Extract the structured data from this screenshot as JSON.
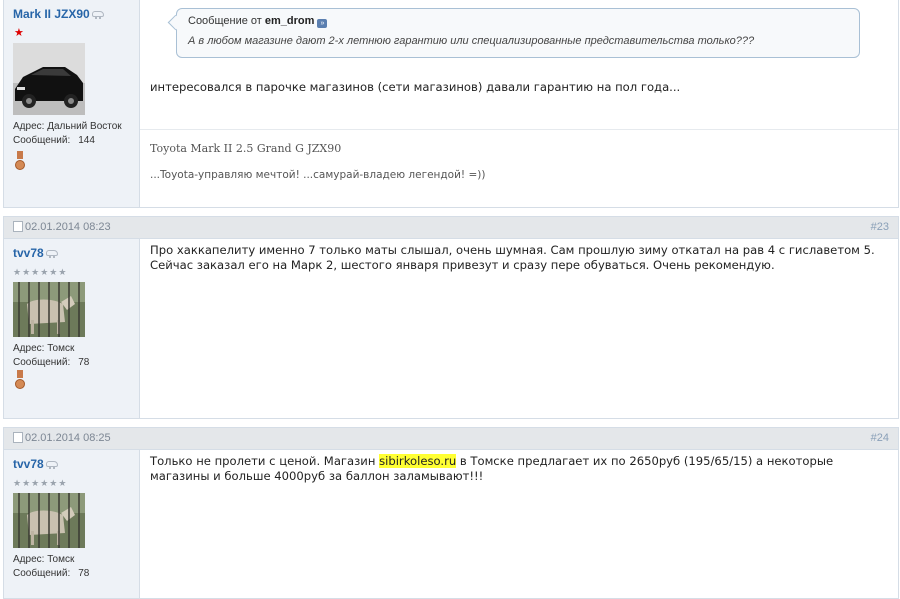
{
  "posts": [
    {
      "username": "Mark II JZX90",
      "address_label": "Адрес:",
      "address": "Дальний Восток",
      "messages_label": "Сообщений:",
      "messages": "144",
      "quote": {
        "prefix": "Сообщение от",
        "author": "em_drom",
        "text": "А в любом магазине дают 2-х летнюю гарантию или специализированные представительства только???"
      },
      "body": "интересовался в парочке магазинов (сети магазинов) давали гарантию на пол года...",
      "signature_line1": "Toyota Mark II 2.5 Grand G JZX90",
      "signature_line2": "...Toyota-управляю мечтой! ...самурай-владею легендой! =))"
    },
    {
      "date": "02.01.2014 08:23",
      "number": "#23",
      "username": "tvv78",
      "stars": "★★★★★★",
      "address_label": "Адрес:",
      "address": "Томск",
      "messages_label": "Сообщений:",
      "messages": "78",
      "body_line1": "Про хаккапелиту именно 7 только маты слышал, очень шумная. Сам прошлую зиму откатал на рав 4 с гиславетом 5.",
      "body_line2": "Сейчас заказал его на Марк 2, шестого января привезут и сразу пере обуваться. Очень рекомендую."
    },
    {
      "date": "02.01.2014 08:25",
      "number": "#24",
      "username": "tvv78",
      "stars": "★★★★★★",
      "address_label": "Адрес:",
      "address": "Томск",
      "messages_label": "Сообщений:",
      "messages": "78",
      "body_line1_pre": "Только не пролети с ценой. Магазин ",
      "body_link": "sibirkoleso.ru",
      "body_line1_post": " в Томске предлагает их по 2650руб (195/65/15) а некоторые",
      "body_line2": "магазины и больше 4000руб за баллон заламывают!!!"
    }
  ],
  "colors": {
    "username": "#2765a8",
    "header_bg": "#e4e7ea",
    "user_col_bg": "#eef2f7",
    "highlight": "#ffff33"
  }
}
